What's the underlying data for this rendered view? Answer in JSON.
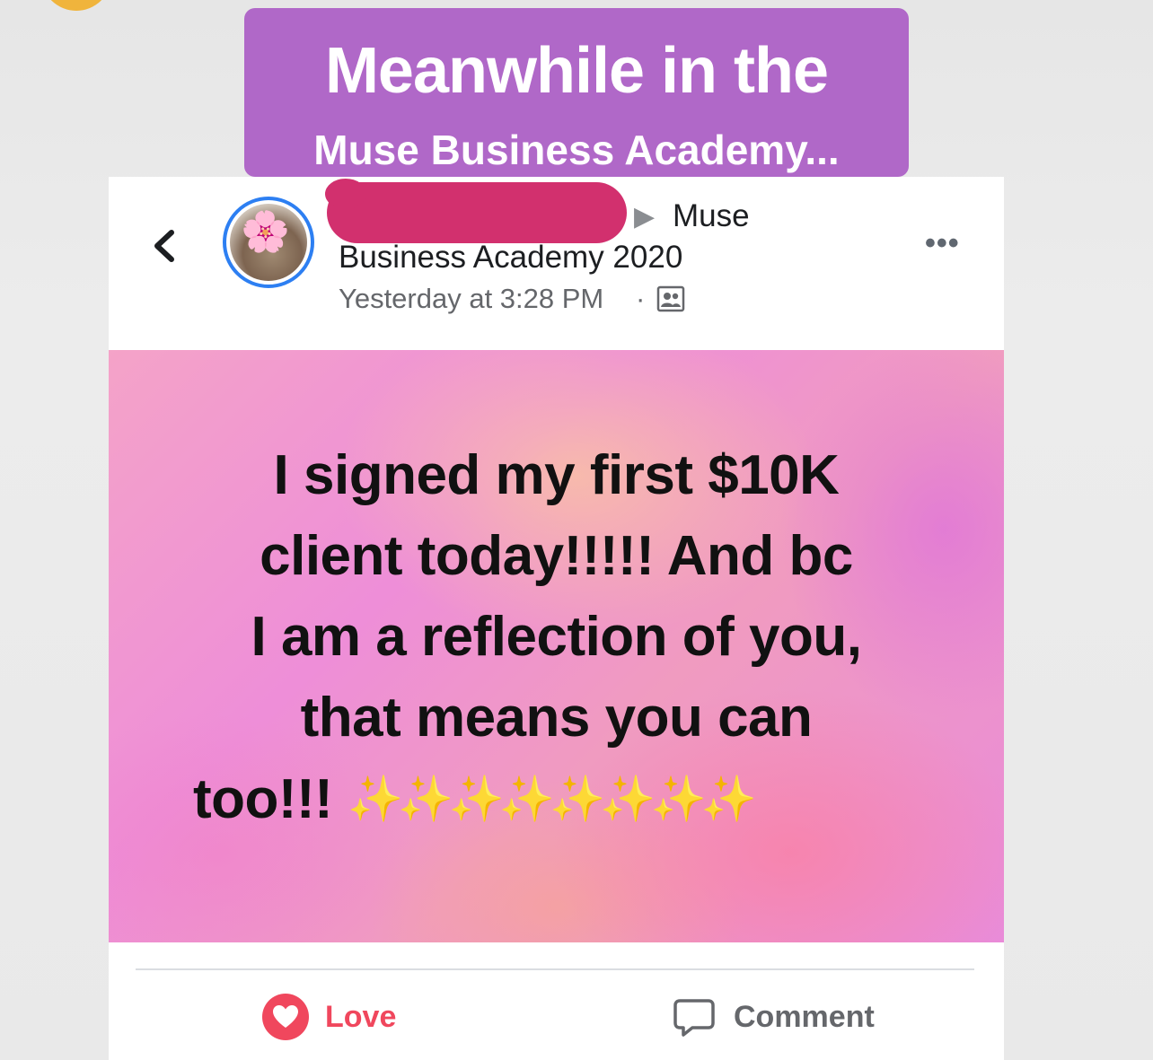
{
  "caption": {
    "line1": "Meanwhile in the",
    "line2": "Muse Business Academy..."
  },
  "post_header": {
    "back_icon": "chevron-left-icon",
    "group_name_part1": "Muse",
    "group_name_part2": "Business Academy 2020",
    "timestamp": "Yesterday at 3:28 PM",
    "separator": "·",
    "privacy_icon": "group-members-icon",
    "more_icon": "more-options-icon",
    "more_glyph": "•••",
    "author_name": "redacted"
  },
  "post_image": {
    "lines": [
      "I signed my first $10K",
      "client today!!!!! And bc",
      "I am a reflection of you,",
      "that means you can",
      "too!!!"
    ],
    "sparkles": "✨✨✨✨✨✨✨✨"
  },
  "actions": {
    "love_label": "Love",
    "love_icon": "heart-icon",
    "comment_label": "Comment",
    "comment_icon": "comment-bubble-icon"
  },
  "colors": {
    "caption_bg": "#b068c8",
    "redaction": "#d2306e",
    "avatar_ring": "#2d7ff2",
    "love": "#f0475d"
  }
}
